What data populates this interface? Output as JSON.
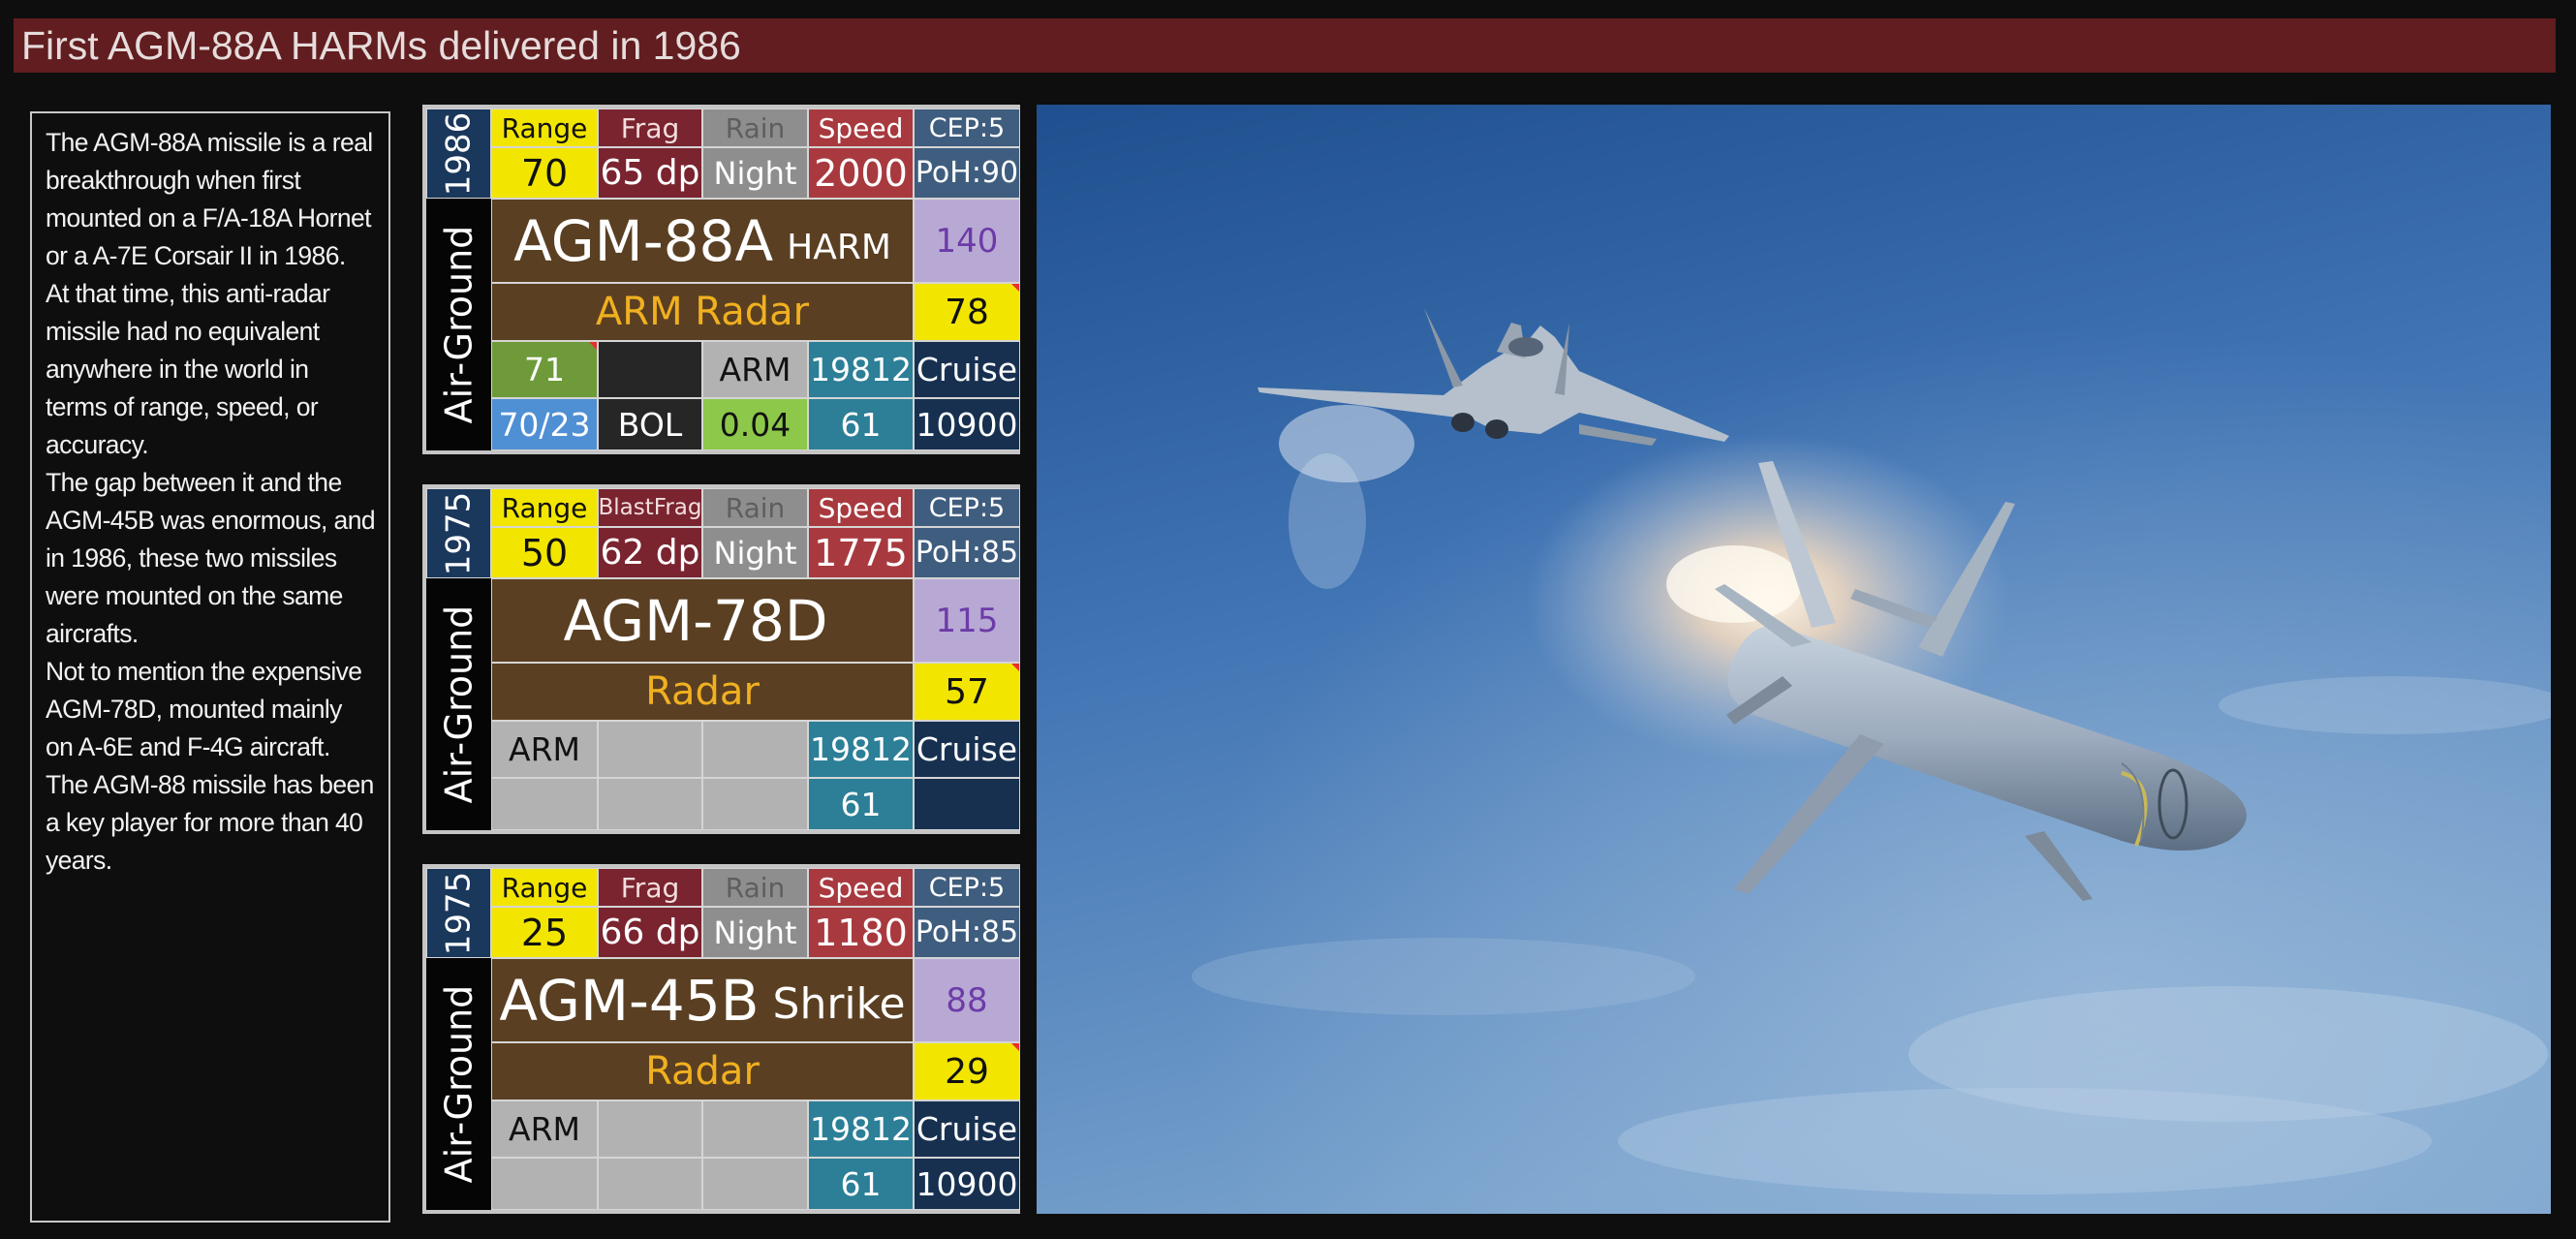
{
  "title": "First AGM-88A HARMs delivered in 1986",
  "paragraphs": [
    "The AGM-88A missile is a real breakthrough when first mounted on a F/A-18A Hornet or a A-7E Corsair II in 1986.",
    "At that time, this anti-radar missile had no equivalent anywhere in the world in terms of range, speed, or accuracy.",
    "The gap between it and the AGM-45B was enormous, and in 1986, these two missiles were mounted on the same aircrafts.",
    "Not to mention the expensive AGM-78D, mounted mainly on A-6E and F-4G aircraft.",
    "The AGM-88 missile has been a key player for more than 40 years."
  ],
  "cards": [
    {
      "year": "1986",
      "range_label": "Range",
      "range": "70",
      "frag_label": "Frag",
      "frag": "65 dp",
      "rain_label": "Rain",
      "night_label": "Night",
      "speed_label": "Speed",
      "speed": "2000",
      "cep": "CEP:5",
      "poh": "PoH:90",
      "role": "Air-Ground",
      "name": "AGM-88A",
      "name_suffix": "HARM",
      "score": "140",
      "seeker": "ARM Radar",
      "rating": "78",
      "r3": [
        "71",
        "",
        "ARM",
        "19812",
        "Cruise"
      ],
      "r4": [
        "70/23",
        "BOL",
        "0.04",
        "61",
        "10900"
      ]
    },
    {
      "year": "1975",
      "range_label": "Range",
      "range": "50",
      "frag_label": "BlastFrag",
      "frag": "62 dp",
      "rain_label": "Rain",
      "night_label": "Night",
      "speed_label": "Speed",
      "speed": "1775",
      "cep": "CEP:5",
      "poh": "PoH:85",
      "role": "Air-Ground",
      "name": "AGM-78D",
      "name_suffix": "",
      "score": "115",
      "seeker": "Radar",
      "rating": "57",
      "r3": [
        "ARM",
        "",
        "",
        "19812",
        "Cruise"
      ],
      "r4": [
        "",
        "",
        "",
        "61",
        ""
      ]
    },
    {
      "year": "1975",
      "range_label": "Range",
      "range": "25",
      "frag_label": "Frag",
      "frag": "66 dp",
      "rain_label": "Rain",
      "night_label": "Night",
      "speed_label": "Speed",
      "speed": "1180",
      "cep": "CEP:5",
      "poh": "PoH:85",
      "role": "Air-Ground",
      "name": "AGM-45B",
      "name_suffix": "Shrike",
      "score": "88",
      "seeker": "Radar",
      "rating": "29",
      "r3": [
        "ARM",
        "",
        "",
        "19812",
        "Cruise"
      ],
      "r4": [
        "",
        "",
        "",
        "61",
        "10900"
      ]
    }
  ],
  "colors": {
    "title_bg": "#611d1f",
    "navy": "#1a375c",
    "yellow": "#f2e600",
    "maroon": "#7a2430",
    "grey": "#8e8e8e",
    "speed_red": "#a83a3f",
    "steel": "#3f5d7e",
    "brown": "#5a3f22",
    "orange_text": "#f0b020",
    "lavender": "#b7a9d4",
    "purple_text": "#6d3ba8",
    "olive": "#6e9a3a",
    "dark": "#262626",
    "lightgrey": "#b2b2b2",
    "teal": "#2c7f97",
    "blue": "#4f8fd3",
    "green": "#8dc84a",
    "deep_navy": "#173050"
  },
  "icons": [
    "fighter-jet-image",
    "missile-image"
  ]
}
